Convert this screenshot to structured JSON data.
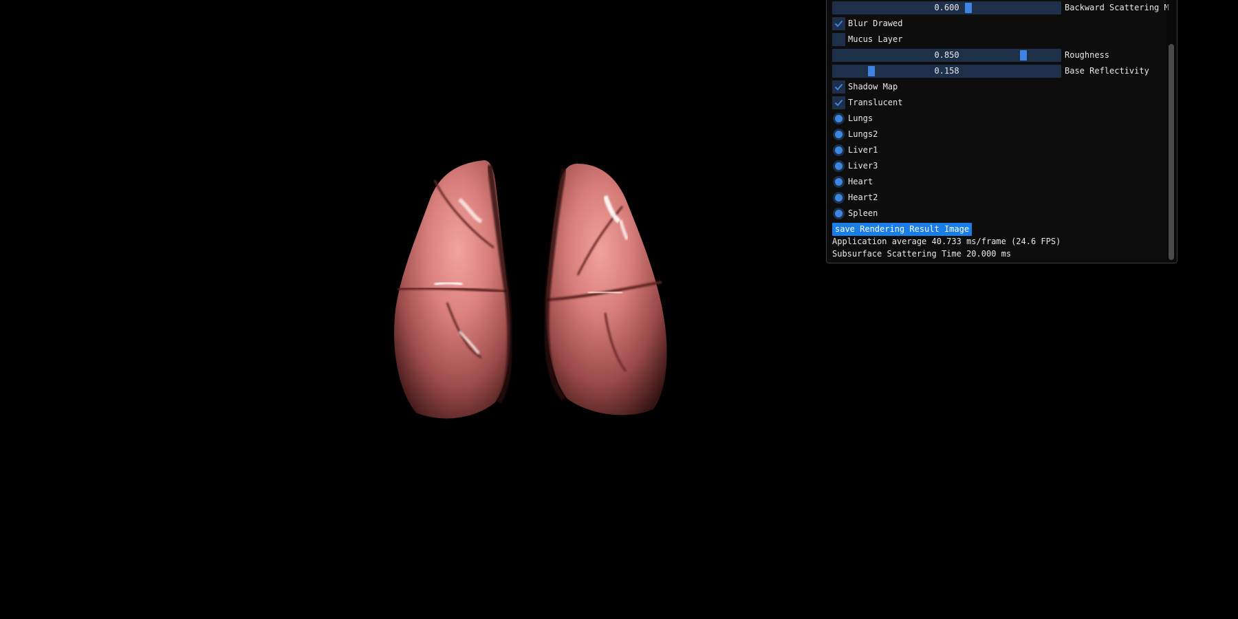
{
  "viewport": {
    "subject": "lungs-render"
  },
  "panel": {
    "sliders": [
      {
        "value": "0.600",
        "label": "Backward Scattering M",
        "fraction": 0.6
      },
      {
        "value": "0.850",
        "label": "Roughness",
        "fraction": 0.85
      },
      {
        "value": "0.158",
        "label": "Base Reflectivity",
        "fraction": 0.158
      }
    ],
    "checkboxes": {
      "blur_drawed": {
        "label": "Blur Drawed",
        "checked": true
      },
      "mucus_layer": {
        "label": "Mucus Layer",
        "checked": false
      },
      "shadow_map": {
        "label": "Shadow Map",
        "checked": true
      },
      "translucent": {
        "label": "Translucent",
        "checked": true
      }
    },
    "radios": [
      {
        "label": "Lungs"
      },
      {
        "label": "Lungs2"
      },
      {
        "label": "Liver1"
      },
      {
        "label": "Liver3"
      },
      {
        "label": "Heart"
      },
      {
        "label": "Heart2"
      },
      {
        "label": "Spleen"
      }
    ],
    "save_button": "save Rendering Result Image",
    "fps_text": "Application average 40.733 ms/frame (24.6 FPS)",
    "sss_text": "Subsurface Scattering Time 20.000 ms"
  },
  "colors": {
    "frame_bg": "#1e2f4a",
    "accent": "#3d85e0",
    "button": "#1a7ee6",
    "panel_bg": "#0e0e0e",
    "text": "#e8e8e8"
  }
}
